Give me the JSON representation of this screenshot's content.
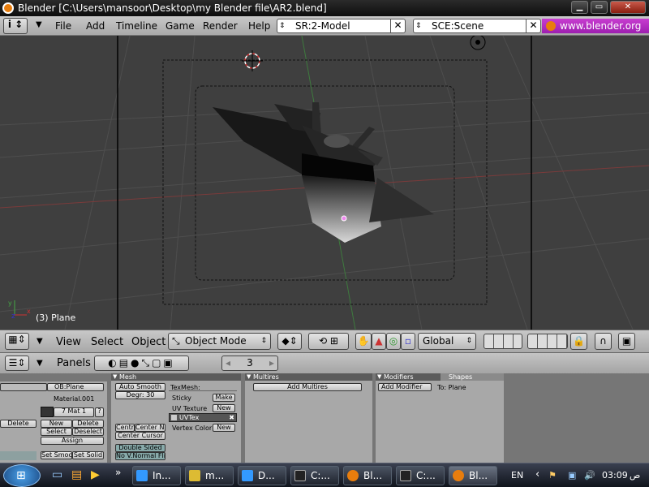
{
  "window": {
    "title": "Blender [C:\\Users\\mansoor\\Desktop\\my Blender file\\AR2.blend]"
  },
  "menubar": {
    "items": [
      "File",
      "Add",
      "Timeline",
      "Game",
      "Render",
      "Help"
    ],
    "screen_field": "SR:2-Model",
    "scene_field": "SCE:Scene",
    "url": "www.blender.org 2"
  },
  "viewport": {
    "object_label": "(3) Plane"
  },
  "view_header": {
    "menus": [
      "View",
      "Select",
      "Object"
    ],
    "mode": "Object Mode",
    "orientation": "Global"
  },
  "buttons_header": {
    "panels_label": "Panels",
    "frame": "3"
  },
  "link_panel": {
    "ob_field": "OB:Plane",
    "material": "Material.001",
    "mat_index": "7 Mat 1",
    "mat_q": "?",
    "delete": "Delete",
    "new": "New",
    "delete2": "Delete",
    "select": "Select",
    "deselect": "Deselect",
    "assign": "Assign",
    "set_smooth": "Set Smoo",
    "set_solid": "Set Solid"
  },
  "mesh_panel": {
    "title": "Mesh",
    "auto_smooth": "Auto Smooth",
    "degr": "Degr: 30",
    "centre": "Centre",
    "center_new": "Center Ne",
    "center_cursor": "Center Cursor",
    "double_sided": "Double Sided",
    "no_vnormal": "No V.Normal Fli",
    "texmesh": "TexMesh:",
    "sticky": "Sticky",
    "make": "Make",
    "uv_texture": "UV Texture",
    "new1": "New",
    "uvtex": "UVTex",
    "vertex_color": "Vertex Color",
    "new2": "New"
  },
  "multires_panel": {
    "title": "Multires",
    "add_button": "Add Multires"
  },
  "modifiers_panel": {
    "title": "Modifiers",
    "shapes_tab": "Shapes",
    "add_button": "Add Modifier",
    "to_label": "To: Plane"
  },
  "taskbar": {
    "tasks": [
      "In...",
      "m...",
      "D...",
      "C:...",
      "Bl...",
      "C:...",
      "Bl..."
    ],
    "lang": "EN",
    "time": "03:09",
    "ampm": "ص"
  },
  "colors": {
    "viewport_bg": "#3f3f3f",
    "url_bg": "#b42ec8",
    "header_bg": "#b8b8b8"
  }
}
